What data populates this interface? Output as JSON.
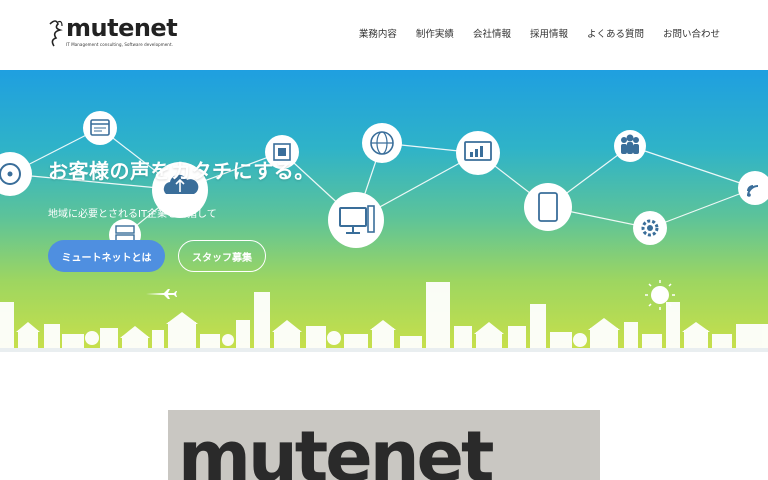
{
  "brand": {
    "name": "mutenet",
    "tagline": "IT Management consulting, Software development."
  },
  "nav": {
    "items": [
      {
        "label": "業務内容"
      },
      {
        "label": "制作実績"
      },
      {
        "label": "会社情報"
      },
      {
        "label": "採用情報"
      },
      {
        "label": "よくある質問"
      },
      {
        "label": "お問い合わせ"
      }
    ]
  },
  "hero": {
    "title": "お客様の声をカタチにする。",
    "subtitle": "地域に必要とされるIT企業を目指して",
    "primary_button": "ミュートネットとは",
    "secondary_button": "スタッフ募集"
  },
  "photo": {
    "sign_text": "mutenet"
  },
  "colors": {
    "hero_top": "#1f9fe0",
    "hero_bottom": "#c9e04a",
    "button_primary": "#4f8fe0",
    "node_icon": "#3a6e9a"
  }
}
